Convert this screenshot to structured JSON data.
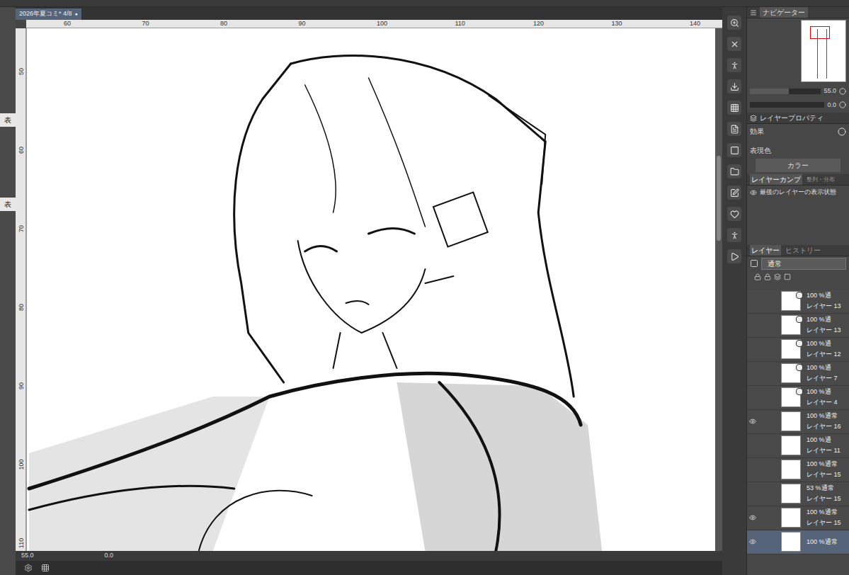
{
  "document_tab": {
    "label": "2026年夏コミ* 4/8",
    "modified_mark": "●",
    "selected": true
  },
  "ruler": {
    "top": [
      "60",
      "70",
      "80",
      "90",
      "100",
      "110",
      "120",
      "130",
      "140"
    ],
    "left": [
      "50",
      "60",
      "70",
      "80",
      "90",
      "100",
      "110"
    ]
  },
  "left_panel": {
    "labels": [
      "表",
      "表"
    ]
  },
  "status_bar": {
    "zoom": "55.0",
    "angle": "0.0"
  },
  "navigator": {
    "tab": {
      "label": "ナビゲーター",
      "selected": true
    },
    "zoom": "55.0",
    "angle": "0.0",
    "zoom_level": 0.55
  },
  "layer_property": {
    "title": "レイヤープロパティ",
    "effect_label": "効果",
    "color_label": "表現色",
    "color_value": "カラー"
  },
  "layer_comp": {
    "tabs": [
      {
        "label": "レイヤーカンプ",
        "selected": true
      },
      {
        "label": "整列・分布",
        "selected": false
      }
    ],
    "item": "最後のレイヤーの表示状態"
  },
  "layers": {
    "tabs": [
      {
        "label": "レイヤー",
        "selected": true
      },
      {
        "label": "ヒストリー",
        "selected": false
      }
    ],
    "blend_mode": "通常",
    "items": [
      {
        "mode": "100 %通",
        "name": "レイヤー 13",
        "visible": false,
        "clipping": true,
        "selected": false
      },
      {
        "mode": "100 %通",
        "name": "レイヤー 13",
        "visible": false,
        "clipping": true,
        "selected": false
      },
      {
        "mode": "100 %通",
        "name": "レイヤー 12",
        "visible": false,
        "clipping": true,
        "selected": false
      },
      {
        "mode": "100 %通",
        "name": "レイヤー 7",
        "visible": false,
        "clipping": true,
        "selected": false
      },
      {
        "mode": "100 %通",
        "name": "レイヤー 4",
        "visible": false,
        "clipping": true,
        "selected": false
      },
      {
        "mode": "100 %通常",
        "name": "レイヤー 16",
        "visible": true,
        "clipping": false,
        "selected": false
      },
      {
        "mode": "100 %通",
        "name": "レイヤー 11",
        "visible": false,
        "clipping": false,
        "selected": false
      },
      {
        "mode": "100 %通常",
        "name": "レイヤー 15",
        "visible": false,
        "clipping": false,
        "selected": false
      },
      {
        "mode": "53 %通常",
        "name": "レイヤー 15",
        "visible": false,
        "clipping": false,
        "selected": false
      },
      {
        "mode": "100 %通常",
        "name": "レイヤー 15",
        "visible": true,
        "clipping": false,
        "selected": false
      },
      {
        "mode": "100 %通常",
        "name": "",
        "visible": true,
        "clipping": false,
        "selected": true
      }
    ]
  }
}
